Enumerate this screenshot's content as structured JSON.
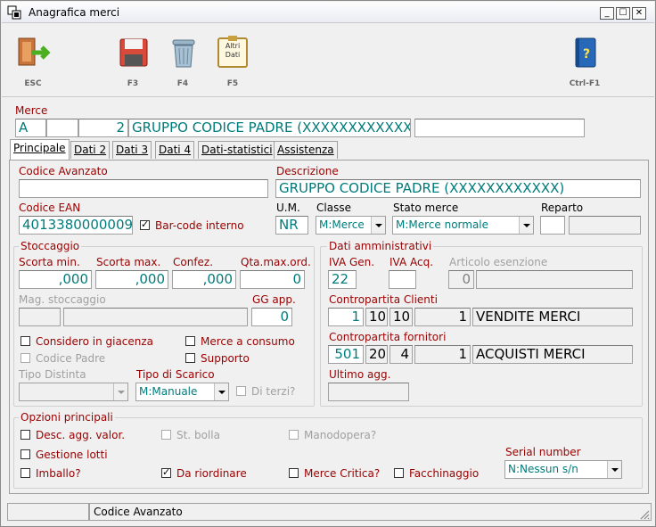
{
  "window": {
    "title": "Anagrafica merci",
    "min": "_",
    "max": "☐",
    "close": "✕"
  },
  "toolbar": {
    "esc": "ESC",
    "f3": "F3",
    "f4": "F4",
    "f5": "F5",
    "f5_icon_text": "Altri Dati",
    "ctrl_f1": "Ctrl-F1"
  },
  "merce": {
    "label": "Merce",
    "code1": "A",
    "code2": "",
    "code3": "2",
    "name": "GRUPPO CODICE PADRE (XXXXXXXXXXXX)",
    "extra": ""
  },
  "tabs": [
    "Principale",
    "Dati 2",
    "Dati 3",
    "Dati 4",
    "Dati-statistici",
    "Assistenza"
  ],
  "main": {
    "codice_avanzato_label": "Codice Avanzato",
    "codice_avanzato": "",
    "descrizione_label": "Descrizione",
    "descrizione": "GRUPPO CODICE PADRE (XXXXXXXXXXXX)",
    "ean_label": "Codice EAN",
    "ean": "4013380000009",
    "barcode_label": "Bar-code interno",
    "um_label": "U.M.",
    "um": "NR",
    "classe_label": "Classe",
    "classe": "M:Merce",
    "stato_label": "Stato merce",
    "stato": "M:Merce normale",
    "reparto_label": "Reparto",
    "reparto1": "",
    "reparto2": ""
  },
  "stoccaggio": {
    "title": "Stoccaggio",
    "scorta_min_label": "Scorta min.",
    "scorta_min": ",000",
    "scorta_max_label": "Scorta max.",
    "scorta_max": ",000",
    "confez_label": "Confez.",
    "confez": ",000",
    "qta_label": "Qta.max.ord.",
    "qta": "0",
    "mag_label": "Mag. stoccaggio",
    "mag1": "",
    "mag2": "",
    "gg_label": "GG app.",
    "gg": "0",
    "giacenza": "Considero in giacenza",
    "consumo": "Merce a consumo",
    "padre": "Codice Padre",
    "supporto": "Supporto",
    "tipo_distinta_label": "Tipo Distinta",
    "tipo_distinta": "",
    "scarico_label": "Tipo di Scarico",
    "scarico": "M:Manuale",
    "terzi": "Di terzi?"
  },
  "amm": {
    "title": "Dati amministrativi",
    "iva_gen_label": "IVA Gen.",
    "iva_gen": "22",
    "iva_acq_label": "IVA Acq.",
    "iva_acq": "",
    "art_esenz_label": "Articolo esenzione",
    "art_esenz_code": "0",
    "art_esenz": "",
    "clienti_label": "Contropartita Clienti",
    "clienti": [
      "1",
      "10",
      "10",
      "1",
      "VENDITE MERCI"
    ],
    "fornitori_label": "Contropartita fornitori",
    "fornitori": [
      "501",
      "20",
      "4",
      "1",
      "ACQUISTI  MERCI"
    ],
    "ultimo_label": "Ultimo agg.",
    "ultimo": ""
  },
  "opzioni": {
    "title": "Opzioni principali",
    "desc_agg": "Desc. agg. valor.",
    "st_bolla": "St. bolla",
    "manodopera": "Manodopera?",
    "gestione_lotti": "Gestione lotti",
    "imballo": "Imballo?",
    "da_riordinare": "Da riordinare",
    "merce_critica": "Merce Critica?",
    "facchinaggio": "Facchinaggio",
    "serial_label": "Serial number",
    "serial": "N:Nessun s/n"
  },
  "statusbar": {
    "left": "",
    "text": "Codice Avanzato"
  }
}
